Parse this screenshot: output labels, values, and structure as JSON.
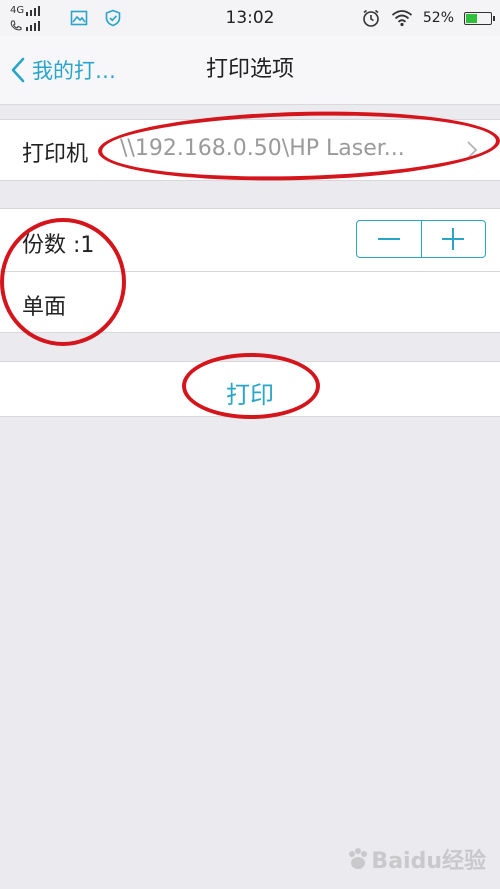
{
  "status_bar": {
    "network": "4G",
    "time": "13:02",
    "battery_text": "52%",
    "battery_level": 0.52,
    "icons": [
      "gallery-icon",
      "shield-icon",
      "alarm-icon",
      "wifi-icon",
      "battery-icon"
    ]
  },
  "nav": {
    "back_label": "我的打…",
    "title": "打印选项"
  },
  "printer_row": {
    "label": "打印机",
    "value": "\\\\192.168.0.50\\HP Laser..."
  },
  "copies_row": {
    "label": "份数 :1"
  },
  "sides_row": {
    "label": "单面"
  },
  "print_button": {
    "label": "打印"
  },
  "watermark": {
    "text": "Baidu经验"
  },
  "colors": {
    "accent": "#2aa5c9",
    "annotation": "#d4151b",
    "background": "#ebebef"
  }
}
